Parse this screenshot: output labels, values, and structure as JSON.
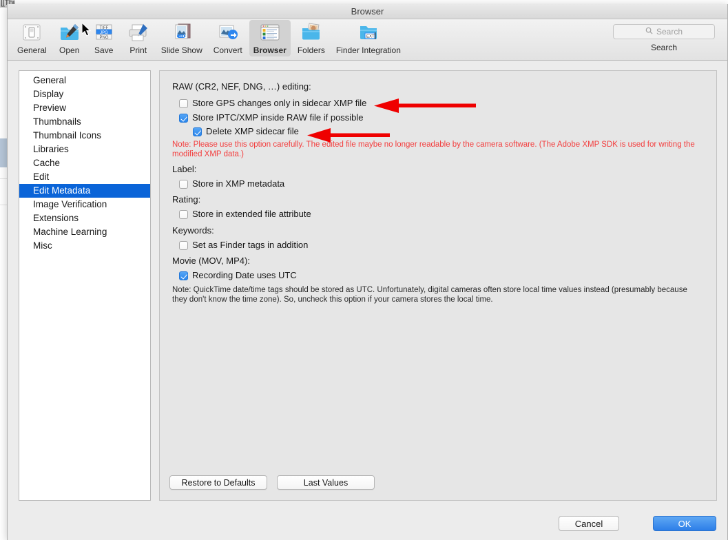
{
  "background_window": {
    "title": "[[ThumbNails] link to Front"
  },
  "window": {
    "title": "Browser"
  },
  "toolbar": {
    "items": [
      {
        "label": "General",
        "icon": "general-prefs-icon",
        "selected": false
      },
      {
        "label": "Open",
        "icon": "open-folder-icon",
        "selected": false
      },
      {
        "label": "Save",
        "icon": "save-formats-icon",
        "selected": false
      },
      {
        "label": "Print",
        "icon": "printer-icon",
        "selected": false
      },
      {
        "label": "Slide Show",
        "icon": "slideshow-icon",
        "selected": false
      },
      {
        "label": "Convert",
        "icon": "convert-icon",
        "selected": false
      },
      {
        "label": "Browser",
        "icon": "browser-window-icon",
        "selected": true
      },
      {
        "label": "Folders",
        "icon": "folders-photo-icon",
        "selected": false
      },
      {
        "label": "Finder Integration",
        "icon": "finder-ext-icon",
        "selected": false
      }
    ],
    "search": {
      "placeholder": "Search",
      "icon": "search-icon",
      "caption": "Search"
    }
  },
  "sidebar": {
    "items": [
      {
        "label": "General",
        "selected": false
      },
      {
        "label": "Display",
        "selected": false
      },
      {
        "label": "Preview",
        "selected": false
      },
      {
        "label": "Thumbnails",
        "selected": false
      },
      {
        "label": "Thumbnail Icons",
        "selected": false
      },
      {
        "label": "Libraries",
        "selected": false
      },
      {
        "label": "Cache",
        "selected": false
      },
      {
        "label": "Edit",
        "selected": false
      },
      {
        "label": "Edit Metadata",
        "selected": true
      },
      {
        "label": "Image Verification",
        "selected": false
      },
      {
        "label": "Extensions",
        "selected": false
      },
      {
        "label": "Machine Learning",
        "selected": false
      },
      {
        "label": "Misc",
        "selected": false
      }
    ]
  },
  "pane": {
    "raw_group_label": "RAW (CR2, NEF, DNG, …) editing:",
    "cb_store_gps": {
      "label": "Store GPS changes only in sidecar XMP file",
      "checked": false
    },
    "cb_store_iptc": {
      "label": "Store IPTC/XMP inside RAW file if possible",
      "checked": true
    },
    "cb_delete_xmp": {
      "label": "Delete XMP sidecar file",
      "checked": true
    },
    "raw_note": "Note: Please use this option carefully. The edited file maybe no longer readable by the camera software. (The Adobe XMP SDK is used for writing the modified XMP data.)",
    "label_group_label": "Label:",
    "cb_label_xmp": {
      "label": "Store in XMP metadata",
      "checked": false
    },
    "rating_group_label": "Rating:",
    "cb_rating_xattr": {
      "label": "Store in extended file attribute",
      "checked": false
    },
    "keywords_group_label": "Keywords:",
    "cb_finder_tags": {
      "label": "Set as Finder tags in addition",
      "checked": false
    },
    "movie_group_label": "Movie (MOV, MP4):",
    "cb_recording_utc": {
      "label": "Recording Date uses UTC",
      "checked": true
    },
    "movie_note": "Note: QuickTime date/time tags should be stored as UTC. Unfortunately, digital cameras often store local time values instead (presumably because they don't know the time zone). So, uncheck this option if your camera stores the local time.",
    "restore_button": "Restore to Defaults",
    "last_values_button": "Last Values"
  },
  "bottom": {
    "cancel_button": "Cancel",
    "ok_button": "OK"
  },
  "annotations": {
    "arrow_color": "#ef0000",
    "arrows": [
      {
        "name": "arrow-to-store-gps-checkbox"
      },
      {
        "name": "arrow-to-delete-xmp-checkbox"
      }
    ]
  },
  "colors": {
    "accent_blue": "#0a64d8",
    "ok_blue": "#2d7fe8",
    "note_red": "#f33d3d",
    "window_bg": "#ececec",
    "pane_bg": "#e6e6e6"
  }
}
